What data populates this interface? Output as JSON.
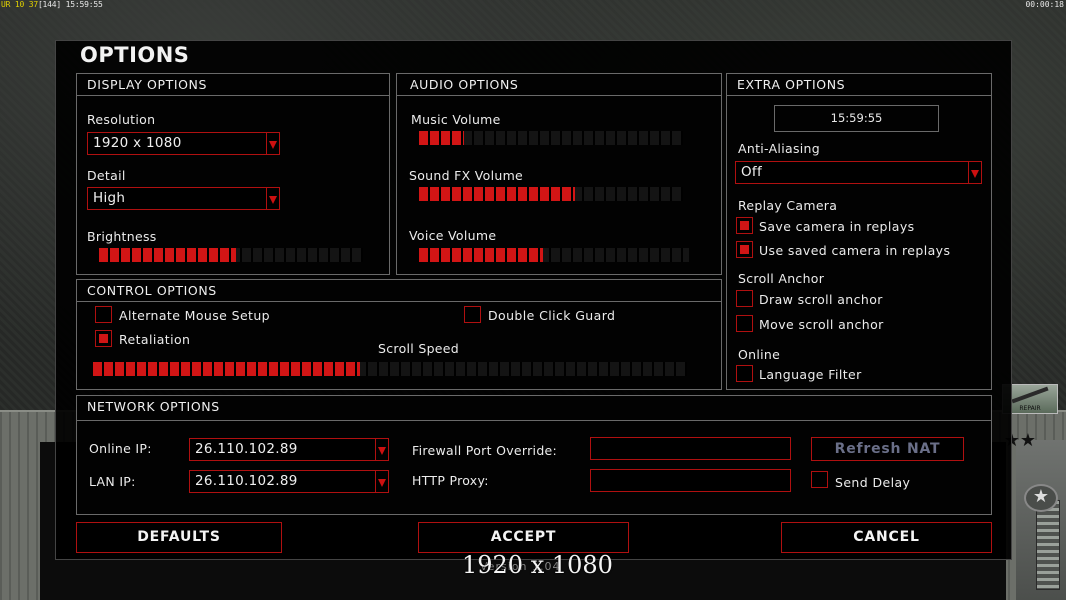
{
  "hud": {
    "left_prefix": "UR 10 37",
    "left_bracket": "[144]",
    "left_time": "15:59:55",
    "right_time": "00:00:18"
  },
  "dialog": {
    "title": "OPTIONS"
  },
  "display": {
    "header": "DISPLAY OPTIONS",
    "resolution_label": "Resolution",
    "resolution_value": "1920 x 1080",
    "detail_label": "Detail",
    "detail_value": "High",
    "brightness_label": "Brightness",
    "brightness_level": 0.52
  },
  "audio": {
    "header": "AUDIO OPTIONS",
    "music_label": "Music Volume",
    "music_level": 0.17,
    "sfx_label": "Sound FX Volume",
    "sfx_level": 0.59,
    "voice_label": "Voice Volume",
    "voice_level": 0.46
  },
  "extra": {
    "header": "EXTRA OPTIONS",
    "time": "15:59:55",
    "aa_label": "Anti-Aliasing",
    "aa_value": "Off",
    "replay_camera_label": "Replay Camera",
    "save_camera_label": "Save camera in replays",
    "save_camera_checked": true,
    "use_camera_label": "Use saved camera in replays",
    "use_camera_checked": true,
    "scroll_anchor_label": "Scroll Anchor",
    "draw_anchor_label": "Draw scroll anchor",
    "draw_anchor_checked": false,
    "move_anchor_label": "Move scroll anchor",
    "move_anchor_checked": false,
    "online_label": "Online",
    "language_filter_label": "Language Filter",
    "language_filter_checked": false
  },
  "control": {
    "header": "CONTROL OPTIONS",
    "alt_mouse_label": "Alternate Mouse Setup",
    "alt_mouse_checked": false,
    "double_click_label": "Double Click Guard",
    "double_click_checked": false,
    "retaliation_label": "Retaliation",
    "retaliation_checked": true,
    "scroll_speed_label": "Scroll Speed",
    "scroll_speed_level": 0.45
  },
  "network": {
    "header": "NETWORK OPTIONS",
    "online_ip_label": "Online IP:",
    "online_ip_value": "26.110.102.89",
    "lan_ip_label": "LAN IP:",
    "lan_ip_value": "26.110.102.89",
    "firewall_label": "Firewall Port Override:",
    "firewall_value": "",
    "proxy_label": "HTTP Proxy:",
    "proxy_value": "",
    "refresh_nat_label": "Refresh NAT",
    "send_delay_label": "Send Delay",
    "send_delay_checked": false
  },
  "buttons": {
    "defaults": "DEFAULTS",
    "accept": "ACCEPT",
    "cancel": "CANCEL"
  },
  "overlay": {
    "resolution_text": "1920 x 1080",
    "version_text": "Version 1.04"
  },
  "colors": {
    "accent": "#d01515",
    "border": "#b01010",
    "panel_border": "#6a6a6a"
  }
}
